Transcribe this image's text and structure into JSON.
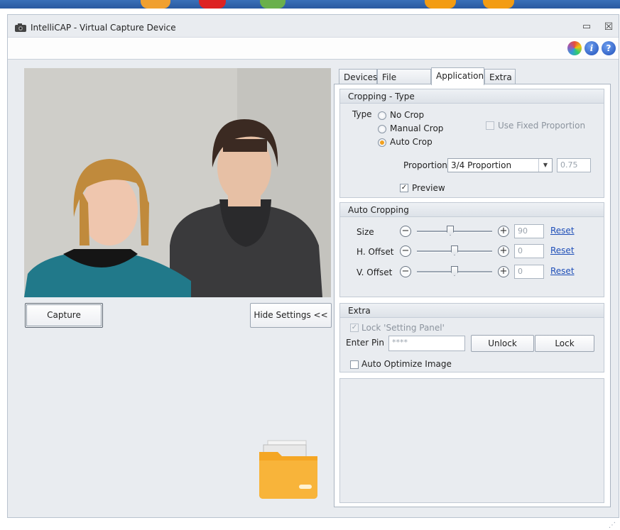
{
  "window": {
    "title": "IntelliCAP - Virtual Capture Device",
    "minimize_glyph": "▭",
    "close_glyph": "☒"
  },
  "toolbar": {
    "icons": [
      "color-wheel-icon",
      "info-icon",
      "help-icon"
    ],
    "info_glyph": "i",
    "help_glyph": "?"
  },
  "left": {
    "capture_label": "Capture",
    "hide_settings_label": "Hide Settings <<"
  },
  "tabs": [
    {
      "label": "Devices",
      "active": false
    },
    {
      "label": "File Settings",
      "active": false
    },
    {
      "label": "Application",
      "active": true
    },
    {
      "label": "Extra",
      "active": false
    }
  ],
  "cropping_type": {
    "header": "Cropping - Type",
    "type_label": "Type",
    "options": [
      "No Crop",
      "Manual Crop",
      "Auto Crop"
    ],
    "selected": "Auto Crop",
    "use_fixed_proportion_label": "Use Fixed Proportion",
    "proportion_label": "Proportion",
    "proportion_value": "3/4 Proportion",
    "proportion_number": "0.75",
    "preview_label": "Preview",
    "preview_checked": true
  },
  "auto_cropping": {
    "header": "Auto Cropping",
    "rows": [
      {
        "label": "Size",
        "value": "90",
        "slider_fraction": 0.45,
        "reset": "Reset"
      },
      {
        "label": "H. Offset",
        "value": "0",
        "slider_fraction": 0.5,
        "reset": "Reset"
      },
      {
        "label": "V. Offset",
        "value": "0",
        "slider_fraction": 0.5,
        "reset": "Reset"
      }
    ]
  },
  "extra": {
    "header": "Extra",
    "lock_setting_panel_label": "Lock 'Setting Panel'",
    "enter_pin_label": "Enter Pin",
    "pin_value": "****",
    "unlock_label": "Unlock",
    "lock_label": "Lock",
    "auto_optimize_label": "Auto Optimize Image"
  },
  "colors": {
    "accent_radio": "#f2a01e",
    "link": "#1f4fb8",
    "folder": "#f5a623"
  }
}
